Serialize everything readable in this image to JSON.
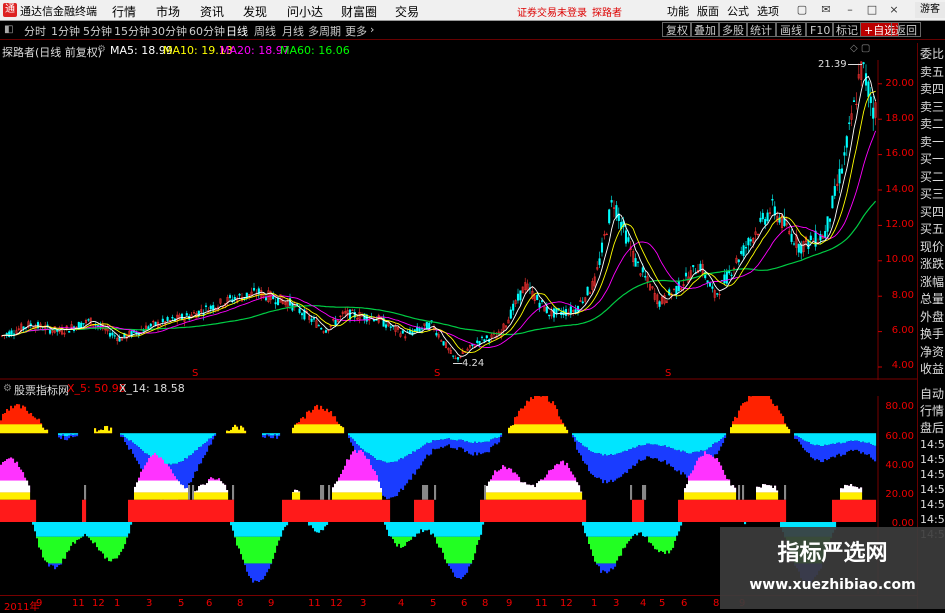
{
  "titlebar": {
    "app_title": "通达信金融终端",
    "menus": [
      "行情",
      "市场",
      "资讯",
      "发现",
      "问小达",
      "财富圈",
      "交易"
    ],
    "warning": "证券交易未登录",
    "warning_user": "探路者",
    "right_menus": [
      "功能",
      "版面",
      "公式",
      "选项"
    ],
    "guest": "游客"
  },
  "periodbar": {
    "periods": [
      "分时",
      "1分钟",
      "5分钟",
      "15分钟",
      "30分钟",
      "60分钟",
      "日线",
      "周线",
      "月线",
      "多周期",
      "更多"
    ],
    "selected": "日线",
    "right_buttons": [
      "复权",
      "叠加",
      "多股",
      "统计",
      "画线",
      "F10",
      "标记",
      "+自选",
      "返回"
    ]
  },
  "main_chart": {
    "stock_title": "探路者(日线 前复权)",
    "ma_legend": [
      {
        "label": "MA5: 18.99",
        "color": "#ffffff"
      },
      {
        "label": "MA10: 19.13",
        "color": "#ffff00"
      },
      {
        "label": "MA20: 18.97",
        "color": "#ff00ff"
      },
      {
        "label": "MA60: 16.06",
        "color": "#00ff00"
      }
    ],
    "y_ticks": [
      "20.00",
      "18.00",
      "16.00",
      "14.00",
      "12.00",
      "10.00",
      "8.00",
      "6.00",
      "4.00"
    ],
    "high_label": "21.39",
    "low_label": "4.24",
    "event_markers": [
      "S",
      "S",
      "S"
    ]
  },
  "indicator": {
    "title": "股票指标网",
    "x5_label": "X_5: 50.96",
    "x14_label": "X_14: 18.58",
    "y_ticks": [
      "80.00",
      "60.00",
      "40.00",
      "20.00",
      "0.00"
    ]
  },
  "x_axis": [
    "2011年",
    "9",
    "11",
    "12",
    "1",
    "3",
    "5",
    "6",
    "8",
    "9",
    "11",
    "12",
    "3",
    "4",
    "5",
    "6",
    "8",
    "9",
    "11",
    "12",
    "1",
    "3",
    "4",
    "5",
    "6",
    "8",
    "9"
  ],
  "sidebar": {
    "items": [
      "委比",
      "卖五",
      "卖四",
      "卖三",
      "卖二",
      "卖一",
      "买一",
      "买二",
      "买三",
      "买四",
      "买五",
      "现价",
      "涨跌",
      "涨幅",
      "总量",
      "外盘",
      "换手",
      "净资",
      "收益"
    ],
    "lower_items": [
      "自动",
      "行情",
      "盘后"
    ],
    "times": [
      "14:56",
      "14:56",
      "14:56",
      "14:56",
      "14:56",
      "14:56",
      "14:56"
    ]
  },
  "watermark": {
    "text": "指标严选网",
    "url": "www.xuezhibiao.com"
  },
  "colors": {
    "up": "#ff3333",
    "down": "#00ffff",
    "ma5": "#ffffff",
    "ma10": "#ffff00",
    "ma20": "#ff00ff",
    "ma60": "#00ff00",
    "axis": "#cc0000"
  }
}
